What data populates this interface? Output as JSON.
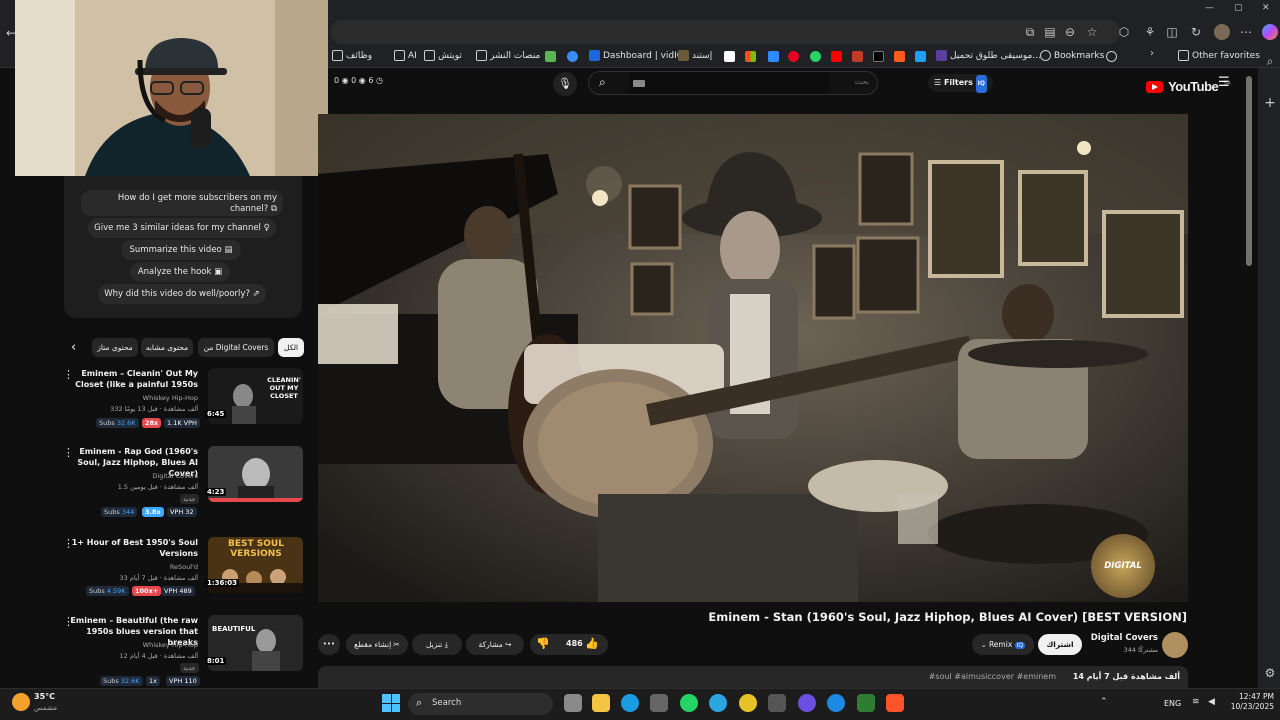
{
  "browser": {
    "bookmarks": [
      "وظائف",
      "AI",
      "تويتش",
      "منصات النشر",
      "Dashboard | vidIQ",
      "إستند",
      "موسيقى طلوق تحميل...",
      "Bookmarks",
      "Other favorites"
    ],
    "window_controls": {
      "min": "—",
      "max": "▢",
      "close": "✕"
    }
  },
  "yt": {
    "logo": "YouTube",
    "region": "SA",
    "search_placeholder": "بحث",
    "filters_label": "Filters",
    "stats_left": "0",
    "stats_mid": "0",
    "stats_right": "6"
  },
  "ai_prompts": [
    "How do I get more subscribers on my channel?",
    "Give me 3 similar ideas for my channel",
    "Summarize this video",
    "Analyze the hook",
    "Why did this video do well/poorly?"
  ],
  "filter_chips": [
    "الكل",
    "من Digital Covers",
    "محتوى مشابه",
    "محتوى متاز"
  ],
  "related": [
    {
      "title": "Eminem – Cleanin' Out My Closet (like a painful 1950s",
      "channel": "Whiskey Hip-Hop",
      "views": "332 ألف مشاهدة · قبل 13 يومًا",
      "subs": "32.6K",
      "mult": "28x",
      "vph": "1.1K VPH",
      "duration": "6:45",
      "thumb_text": "CLEANIN' OUT MY CLOSET",
      "new": ""
    },
    {
      "title": "Eminem - Rap God (1960's Soul, Jazz Hiphop, Blues AI Cover)",
      "channel": "Digital Covers",
      "views": "1.5 ألف مشاهدة · قبل يومين",
      "subs": "344",
      "mult": "3.8x",
      "vph": "VPH 32",
      "duration": "4:23",
      "thumb_text": "",
      "new": "جديد"
    },
    {
      "title": "1+ Hour of Best 1950's Soul Versions",
      "channel": "ReSoul'd",
      "views": "33 ألف مشاهدة · قبل 7 أيام",
      "subs": "4.59K",
      "mult": "100x+",
      "vph": "VPH 489",
      "duration": "1:36:03",
      "thumb_text": "BEST SOUL VERSIONS",
      "new": ""
    },
    {
      "title": "Eminem – Beautiful (the raw 1950s blues version that breaks",
      "channel": "Whiskey Hip-Hop",
      "views": "12 ألف مشاهدة · قبل 4 أيام",
      "subs": "32.6K",
      "mult": "1x",
      "vph": "VPH 110",
      "duration": "8:01",
      "thumb_text": "BEAUTIFUL",
      "new": "جديد"
    }
  ],
  "video": {
    "title": "Eminem - Stan (1960's Soul, Jazz Hiphop, Blues AI Cover) [BEST VERSION]",
    "watermark": "DIGITAL COVERS",
    "channel": "Digital Covers",
    "subs": "344 مشتركًا",
    "subscribe": "اشتراك",
    "remix": "Remix",
    "likes": "486",
    "share": "مشاركة",
    "download": "تنزيل",
    "clip": "إنشاء مقطع",
    "more": "•••",
    "desc_views": "14 ألف مشاهدة قبل 7 أيام",
    "desc_tags": "#soul #aimusiccover #eminem"
  },
  "taskbar": {
    "temp": "35°C",
    "weather": "مشمس",
    "search": "Search",
    "lang": "ENG",
    "time": "12:47 PM",
    "date": "10/23/2025"
  },
  "colors": {
    "accent": "#3ea6ff",
    "yt_red": "#ff0000",
    "badge_red": "#e5484d"
  }
}
